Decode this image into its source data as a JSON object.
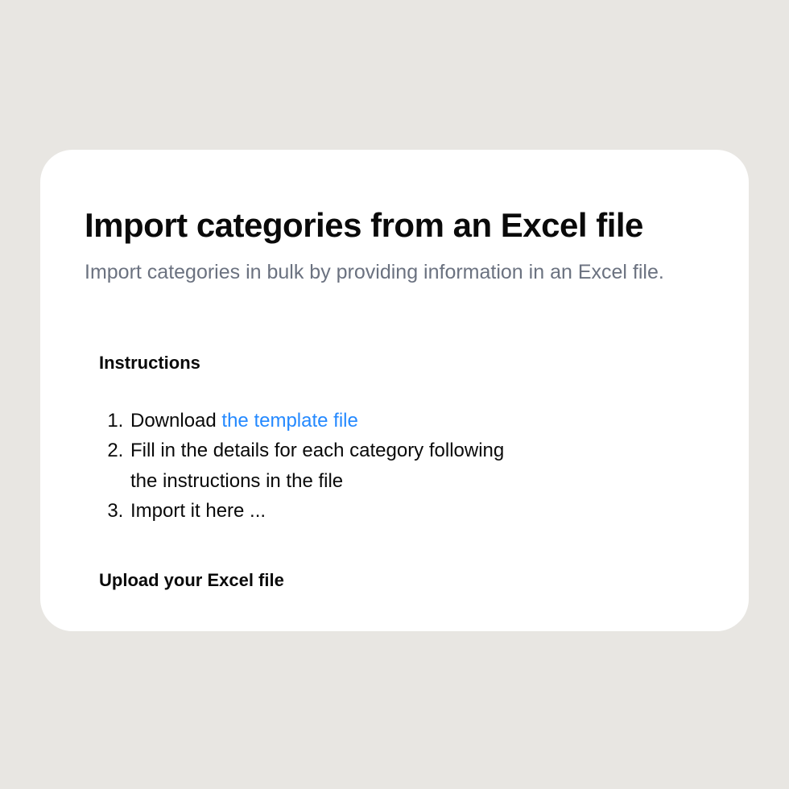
{
  "header": {
    "title": "Import categories from an Excel file",
    "subtitle": "Import categories in bulk by providing information in an Excel file."
  },
  "instructions": {
    "label": "Instructions",
    "steps": {
      "0": {
        "prefix": "Download ",
        "link": "the template file"
      },
      "1": {
        "text": "Fill in the details for each category following the instructions in the file"
      },
      "2": {
        "text": "Import it here ..."
      }
    }
  },
  "upload": {
    "label": "Upload your Excel file"
  }
}
